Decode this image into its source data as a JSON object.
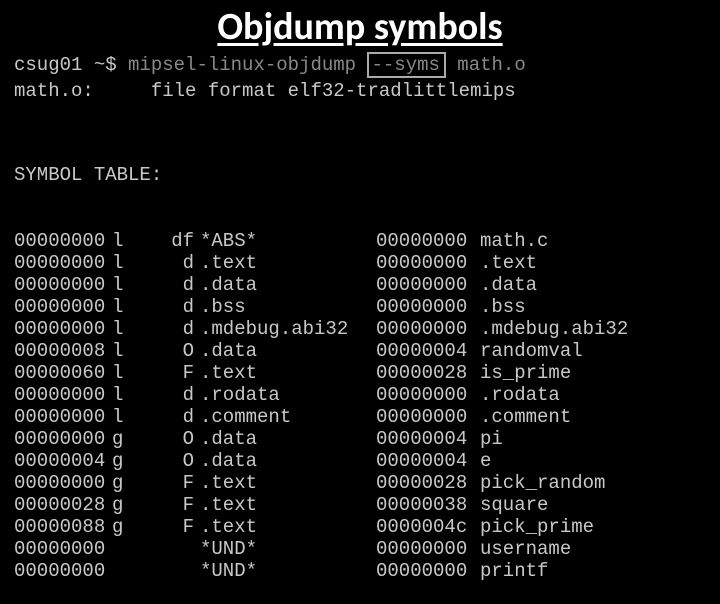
{
  "title": "Objdump symbols",
  "prompt": "csug01 ~$ ",
  "command": "mipsel-linux-objdump ",
  "flag": "--syms",
  "argfile": " math.o",
  "fileformat_left": "math.o:     file format elf32-tradlittlemips",
  "symhdr": "SYMBOL TABLE:",
  "rows": [
    {
      "a": "00000000",
      "b": "l",
      "c": "df",
      "d": "*ABS*",
      "e": "00000000",
      "f": "math.c"
    },
    {
      "a": "00000000",
      "b": "l",
      "c": "d",
      "d": ".text",
      "e": "00000000",
      "f": ".text"
    },
    {
      "a": "00000000",
      "b": "l",
      "c": "d",
      "d": ".data",
      "e": "00000000",
      "f": ".data"
    },
    {
      "a": "00000000",
      "b": "l",
      "c": "d",
      "d": ".bss",
      "e": "00000000",
      "f": ".bss"
    },
    {
      "a": "00000000",
      "b": "l",
      "c": "d",
      "d": ".mdebug.abi32",
      "e": "00000000",
      "f": ".mdebug.abi32"
    },
    {
      "a": "00000008",
      "b": "l",
      "c": "O",
      "d": ".data",
      "e": "00000004",
      "f": "randomval"
    },
    {
      "a": "00000060",
      "b": "l",
      "c": "F",
      "d": ".text",
      "e": "00000028",
      "f": "is_prime"
    },
    {
      "a": "00000000",
      "b": "l",
      "c": "d",
      "d": ".rodata",
      "e": "00000000",
      "f": ".rodata"
    },
    {
      "a": "00000000",
      "b": "l",
      "c": "d",
      "d": ".comment",
      "e": "00000000",
      "f": ".comment"
    },
    {
      "a": "00000000",
      "b": "g",
      "c": "O",
      "d": ".data",
      "e": "00000004",
      "f": "pi"
    },
    {
      "a": "00000004",
      "b": "g",
      "c": "O",
      "d": ".data",
      "e": "00000004",
      "f": "e"
    },
    {
      "a": "00000000",
      "b": "g",
      "c": "F",
      "d": ".text",
      "e": "00000028",
      "f": "pick_random"
    },
    {
      "a": "00000028",
      "b": "g",
      "c": "F",
      "d": ".text",
      "e": "00000038",
      "f": "square"
    },
    {
      "a": "00000088",
      "b": "g",
      "c": "F",
      "d": ".text",
      "e": "0000004c",
      "f": "pick_prime"
    },
    {
      "a": "00000000",
      "b": "",
      "c": "",
      "d": "*UND*",
      "e": "00000000",
      "f": "username"
    },
    {
      "a": "00000000",
      "b": "",
      "c": "",
      "d": "*UND*",
      "e": "00000000",
      "f": "printf"
    }
  ]
}
